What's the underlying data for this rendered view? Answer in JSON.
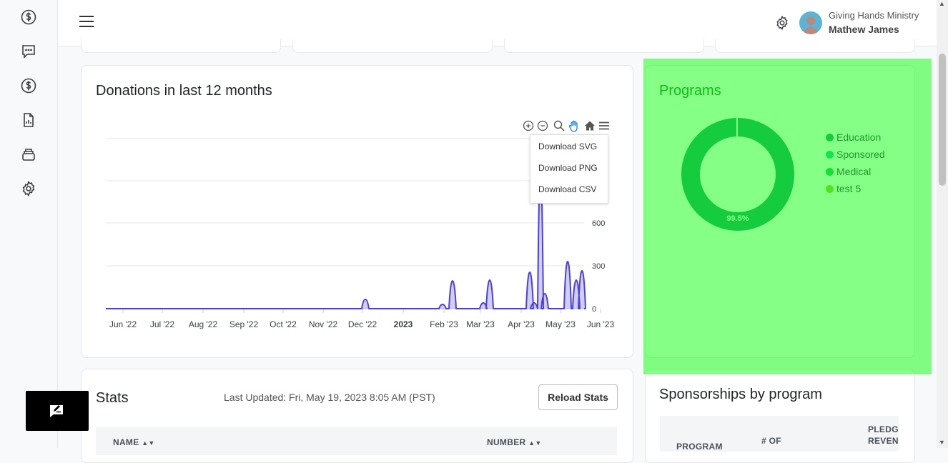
{
  "topbar": {
    "org_name": "Giving Hands Ministry",
    "user_name": "Mathew James"
  },
  "sidebar": {
    "icons": [
      "dollar-circle-icon",
      "chat-icon",
      "dollar-circle-icon",
      "report-icon",
      "stack-icon",
      "gear-icon"
    ]
  },
  "donations": {
    "title": "Donations in last 12 months",
    "menu": [
      "Download SVG",
      "Download PNG",
      "Download CSV"
    ],
    "chart_data": {
      "type": "area",
      "x_ticks": [
        "Jun '22",
        "Jul '22",
        "Aug '22",
        "Sep '22",
        "Oct '22",
        "Nov '22",
        "Dec '22",
        "2023",
        "Feb '23",
        "Mar '23",
        "Apr '23",
        "May '23",
        "Jun '23"
      ],
      "y_ticks": [
        0,
        300,
        600
      ],
      "peaks": [
        {
          "date": "Dec '22",
          "value": 65
        },
        {
          "date": "late Jan '23",
          "value": 30
        },
        {
          "date": "early Feb '23",
          "value": 195
        },
        {
          "date": "late Feb '23",
          "value": 40
        },
        {
          "date": "early Mar '23",
          "value": 200
        },
        {
          "date": "mid Apr '23",
          "value": 255
        },
        {
          "date": "late Apr '23",
          "value": 40
        },
        {
          "date": "late Apr '23",
          "value": 1000
        },
        {
          "date": "late Apr '23",
          "value": 105
        },
        {
          "date": "early May '23",
          "value": 330
        },
        {
          "date": "mid May '23",
          "value": 200
        },
        {
          "date": "late May '23",
          "value": 265
        }
      ],
      "color": "#4b3fe0"
    }
  },
  "programs": {
    "title": "Programs",
    "chart_data": {
      "type": "pie",
      "labels": [
        "Education",
        "Sponsored",
        "Medical",
        "test 5"
      ],
      "values": [
        99.5,
        0.5,
        0,
        0
      ],
      "data_label": "99.5%",
      "colors": [
        "#2a9d78",
        "#26c99a",
        "#22c55e",
        "#9acd32"
      ]
    }
  },
  "stats": {
    "title": "Stats",
    "last_updated": "Last Updated: Fri, May 19, 2023 8:05 AM (PST)",
    "reload_label": "Reload Stats",
    "columns": [
      "NAME",
      "NUMBER"
    ]
  },
  "sponsorships": {
    "title": "Sponsorships by program",
    "columns": [
      "PROGRAM",
      "# OF",
      "PLEDG",
      "REVEN"
    ]
  }
}
